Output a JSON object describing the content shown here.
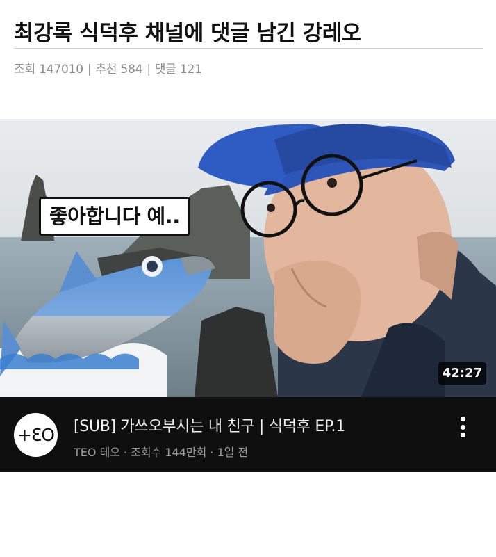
{
  "post": {
    "title": "최강록 식덕후 채널에 댓글 남긴 강레오",
    "meta": {
      "views_label": "조회",
      "views": "147010",
      "recommend_label": "추천",
      "recommend": "584",
      "comments_label": "댓글",
      "comments": "121",
      "separator": "|"
    }
  },
  "video": {
    "thumbnail_caption": "좋아합니다 예..",
    "duration": "42:27",
    "channel_avatar_text": "+ƐO",
    "title": "[SUB] 가쓰오부시는 내 친구 | 식덕후 EP.1",
    "channel_name": "TEO 테오",
    "view_count": "조회수 144만회",
    "uploaded": "1일 전",
    "meta_dot": "·",
    "more_icon": "more-vertical-icon"
  },
  "colors": {
    "info_bar_bg": "#0f0f0f",
    "cap_blue": "#2e56b8",
    "fish_blue": "#5b93d6"
  }
}
